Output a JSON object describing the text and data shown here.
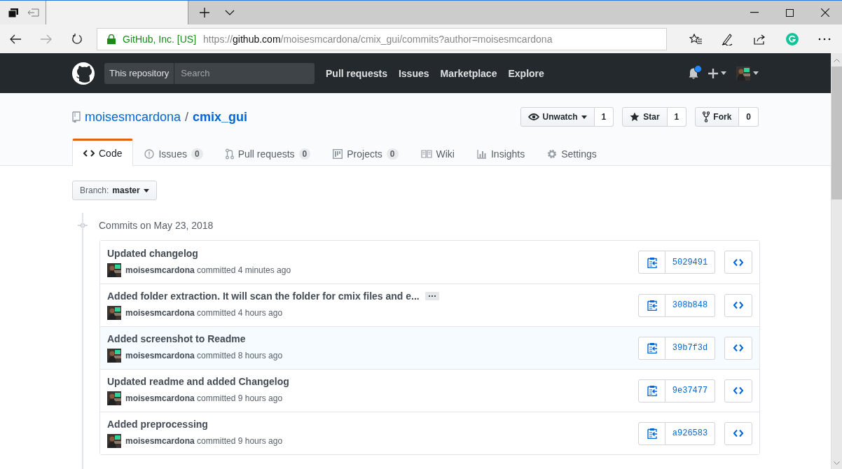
{
  "browser": {
    "address": {
      "identity": "GitHub, Inc. [US]",
      "url_parts": [
        "https://",
        "github.com",
        "/moisesmcardona/cmix_gui/commits?author=moisesmcardona"
      ]
    }
  },
  "header": {
    "search_scope": "This repository",
    "search": {
      "placeholder": "Search"
    },
    "nav": [
      "Pull requests",
      "Issues",
      "Marketplace",
      "Explore"
    ],
    "notification_unread": true
  },
  "repo": {
    "owner": "moisesmcardona",
    "separator": "/",
    "name": "cmix_gui",
    "actions": [
      {
        "kind": "watch",
        "label": "Unwatch",
        "count": "1"
      },
      {
        "kind": "star",
        "label": "Star",
        "count": "1"
      },
      {
        "kind": "fork",
        "label": "Fork",
        "count": "0"
      }
    ],
    "tabs": [
      {
        "kind": "code",
        "label": "Code",
        "selected": true
      },
      {
        "kind": "issues",
        "label": "Issues",
        "count": "0",
        "selected": false
      },
      {
        "kind": "pulls",
        "label": "Pull requests",
        "count": "0",
        "selected": false
      },
      {
        "kind": "projects",
        "label": "Projects",
        "count": "0",
        "selected": false
      },
      {
        "kind": "wiki",
        "label": "Wiki",
        "selected": false
      },
      {
        "kind": "insights",
        "label": "Insights",
        "selected": false
      },
      {
        "kind": "settings",
        "label": "Settings",
        "selected": false
      }
    ]
  },
  "branch": {
    "label": "Branch:",
    "value": "master"
  },
  "commits": {
    "date_heading": "Commits on May 23, 2018",
    "rows": [
      {
        "message": "Updated changelog",
        "meta": "**moisesmcardona** committed 4 minutes ago",
        "sha": "5029491",
        "highlighted": false,
        "has_more": false
      },
      {
        "message": "Added folder extraction. It will scan the folder for cmix files and e...",
        "meta": "**moisesmcardona** committed 4 hours ago",
        "sha": "308b848",
        "highlighted": false,
        "has_more": true
      },
      {
        "message": "Added screenshot to Readme",
        "meta": "**moisesmcardona** committed 8 hours ago",
        "sha": "39b7f3d",
        "highlighted": true,
        "has_more": false
      },
      {
        "message": "Updated readme and added Changelog",
        "meta": "**moisesmcardona** committed 9 hours ago",
        "sha": "9e37477",
        "highlighted": false,
        "has_more": false
      },
      {
        "message": "Added preprocessing",
        "meta": "**moisesmcardona** committed 9 hours ago",
        "sha": "a926583",
        "highlighted": false,
        "has_more": false
      }
    ]
  }
}
